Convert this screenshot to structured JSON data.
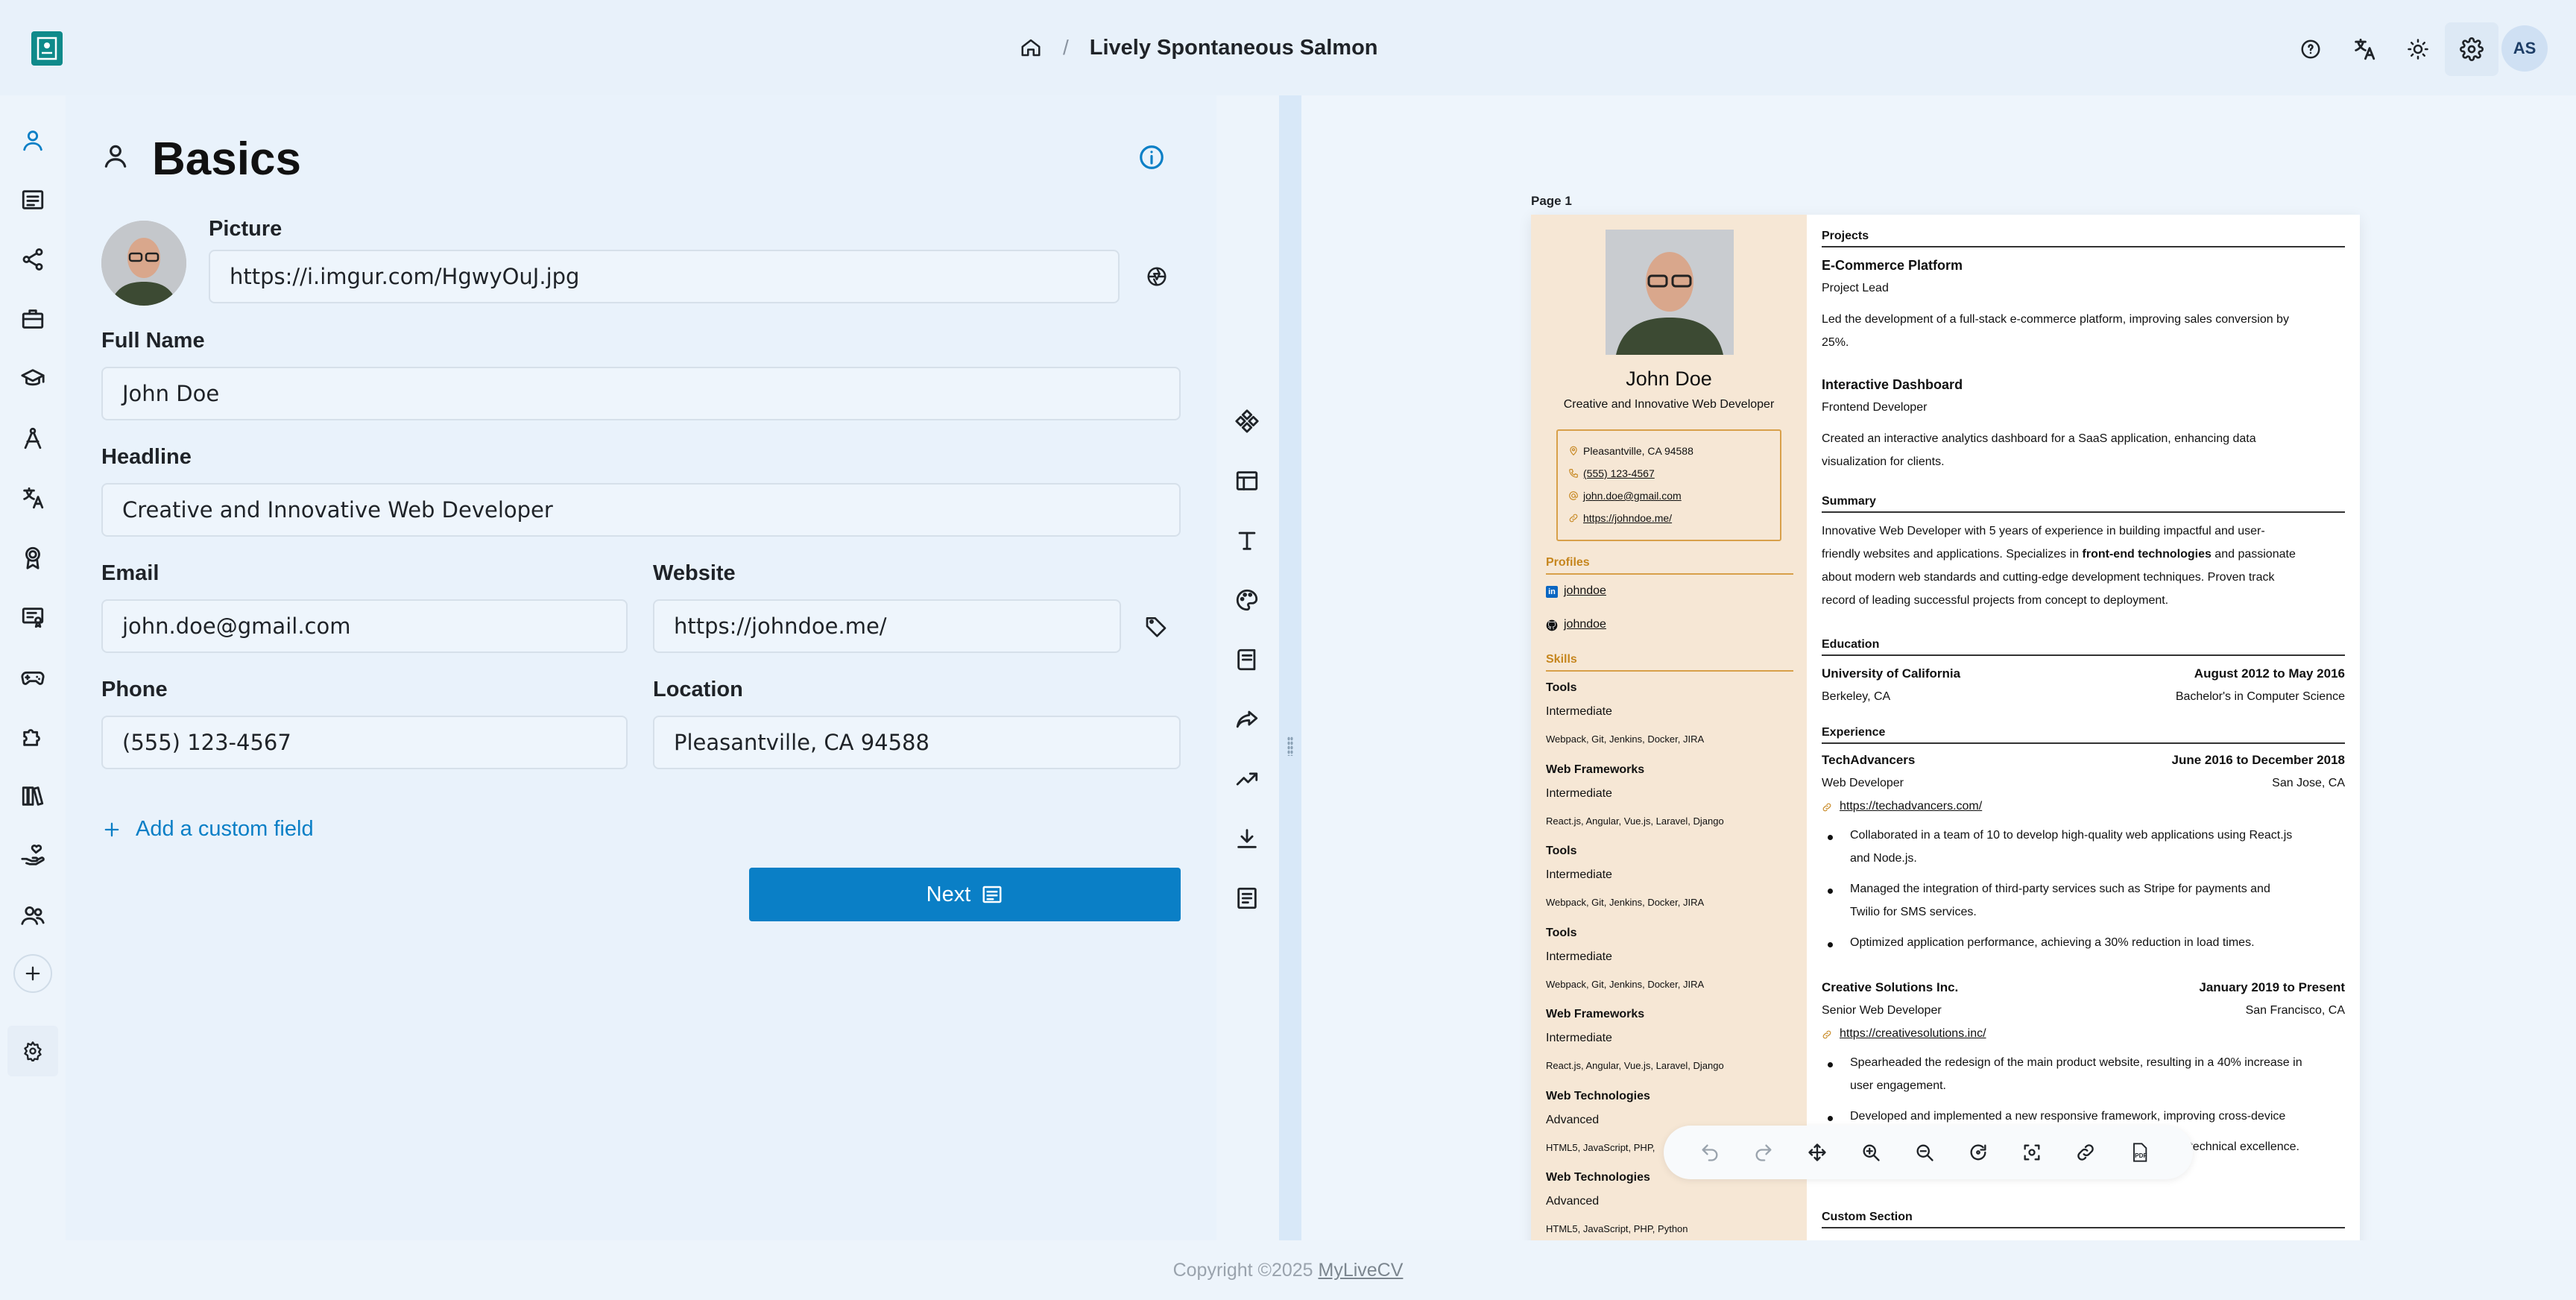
{
  "header": {
    "title": "Lively Spontaneous Salmon",
    "separator": "/",
    "user_initials": "AS"
  },
  "form": {
    "section_title": "Basics",
    "picture_label": "Picture",
    "picture_value": "https://i.imgur.com/HgwyOuJ.jpg",
    "fullname_label": "Full Name",
    "fullname_value": "John Doe",
    "headline_label": "Headline",
    "headline_value": "Creative and Innovative Web Developer",
    "email_label": "Email",
    "email_value": "john.doe@gmail.com",
    "website_label": "Website",
    "website_value": "https://johndoe.me/",
    "phone_label": "Phone",
    "phone_value": "(555) 123-4567",
    "location_label": "Location",
    "location_value": "Pleasantville, CA 94588",
    "add_field_label": "Add a custom field",
    "next_label": "Next"
  },
  "resume": {
    "page_label": "Page 1",
    "name": "John Doe",
    "headline": "Creative and Innovative Web Developer",
    "contact": {
      "location": "Pleasantville, CA 94588",
      "phone": "(555) 123-4567",
      "email": "john.doe@gmail.com",
      "website": "https://johndoe.me/"
    },
    "profiles_heading": "Profiles",
    "profiles": [
      "johndoe",
      "johndoe"
    ],
    "skills_heading": "Skills",
    "skills": [
      {
        "name": "Tools",
        "level": "Intermediate",
        "keywords": "Webpack, Git, Jenkins, Docker, JIRA"
      },
      {
        "name": "Web Frameworks",
        "level": "Intermediate",
        "keywords": "React.js, Angular, Vue.js, Laravel, Django"
      },
      {
        "name": "Tools",
        "level": "Intermediate",
        "keywords": "Webpack, Git, Jenkins, Docker, JIRA"
      },
      {
        "name": "Tools",
        "level": "Intermediate",
        "keywords": "Webpack, Git, Jenkins, Docker, JIRA"
      },
      {
        "name": "Web Frameworks",
        "level": "Intermediate",
        "keywords": "React.js, Angular, Vue.js, Laravel, Django"
      },
      {
        "name": "Web Technologies",
        "level": "Advanced",
        "keywords": "HTML5, JavaScript, PHP,"
      },
      {
        "name": "Web Technologies",
        "level": "Advanced",
        "keywords": "HTML5, JavaScript, PHP, Python"
      }
    ],
    "projects_heading": "Projects",
    "projects": [
      {
        "name": "E-Commerce Platform",
        "role": "Project Lead",
        "desc1": "Led the development of a full-stack e-commerce platform, improving sales conversion by",
        "desc2": "25%."
      },
      {
        "name": "Interactive Dashboard",
        "role": "Frontend Developer",
        "desc1": "Created an interactive analytics dashboard for a SaaS application, enhancing data",
        "desc2": "visualization for clients."
      }
    ],
    "summary_heading": "Summary",
    "summary_lines": [
      "Innovative Web Developer with 5 years of experience in building impactful and user-",
      "friendly websites and applications. Specializes in ",
      "front-end technologies",
      " and passionate",
      "about modern web standards and cutting-edge development techniques. Proven track",
      "record of leading successful projects from concept to deployment."
    ],
    "education_heading": "Education",
    "education": {
      "school": "University of California",
      "dates": "August 2012 to May 2016",
      "location": "Berkeley, CA",
      "degree": "Bachelor's in Computer Science"
    },
    "experience_heading": "Experience",
    "experience": [
      {
        "company": "TechAdvancers",
        "dates": "June 2016 to December 2018",
        "role": "Web Developer",
        "location": "San Jose, CA",
        "url": "https://techadvancers.com/",
        "bullets": [
          [
            "Collaborated in a team of 10 to develop high-quality web applications using React.js",
            "and Node.js."
          ],
          [
            "Managed the integration of third-party services such as Stripe for payments and",
            "Twilio for SMS services."
          ],
          [
            "Optimized application performance, achieving a 30% reduction in load times."
          ]
        ]
      },
      {
        "company": "Creative Solutions Inc.",
        "dates": "January 2019 to Present",
        "role": "Senior Web Developer",
        "location": "San Francisco, CA",
        "url": "https://creativesolutions.inc/",
        "bullets": [
          [
            "Spearheaded the redesign of the main product website, resulting in a 40% increase in",
            "user engagement."
          ],
          [
            "Developed and implemented a new responsive framework, improving cross-device"
          ],
          [
            "Mentored a team of four junior developers, fostering a culture of technical excellence."
          ]
        ]
      }
    ],
    "custom_heading": "Custom Section"
  },
  "footer": {
    "prefix": "Copyright ©2025 ",
    "link": "MyLiveCV"
  },
  "colors": {
    "accent": "#0a7fc6",
    "resume_sidebar": "#f6e7d5",
    "resume_accent": "#c6861e"
  }
}
